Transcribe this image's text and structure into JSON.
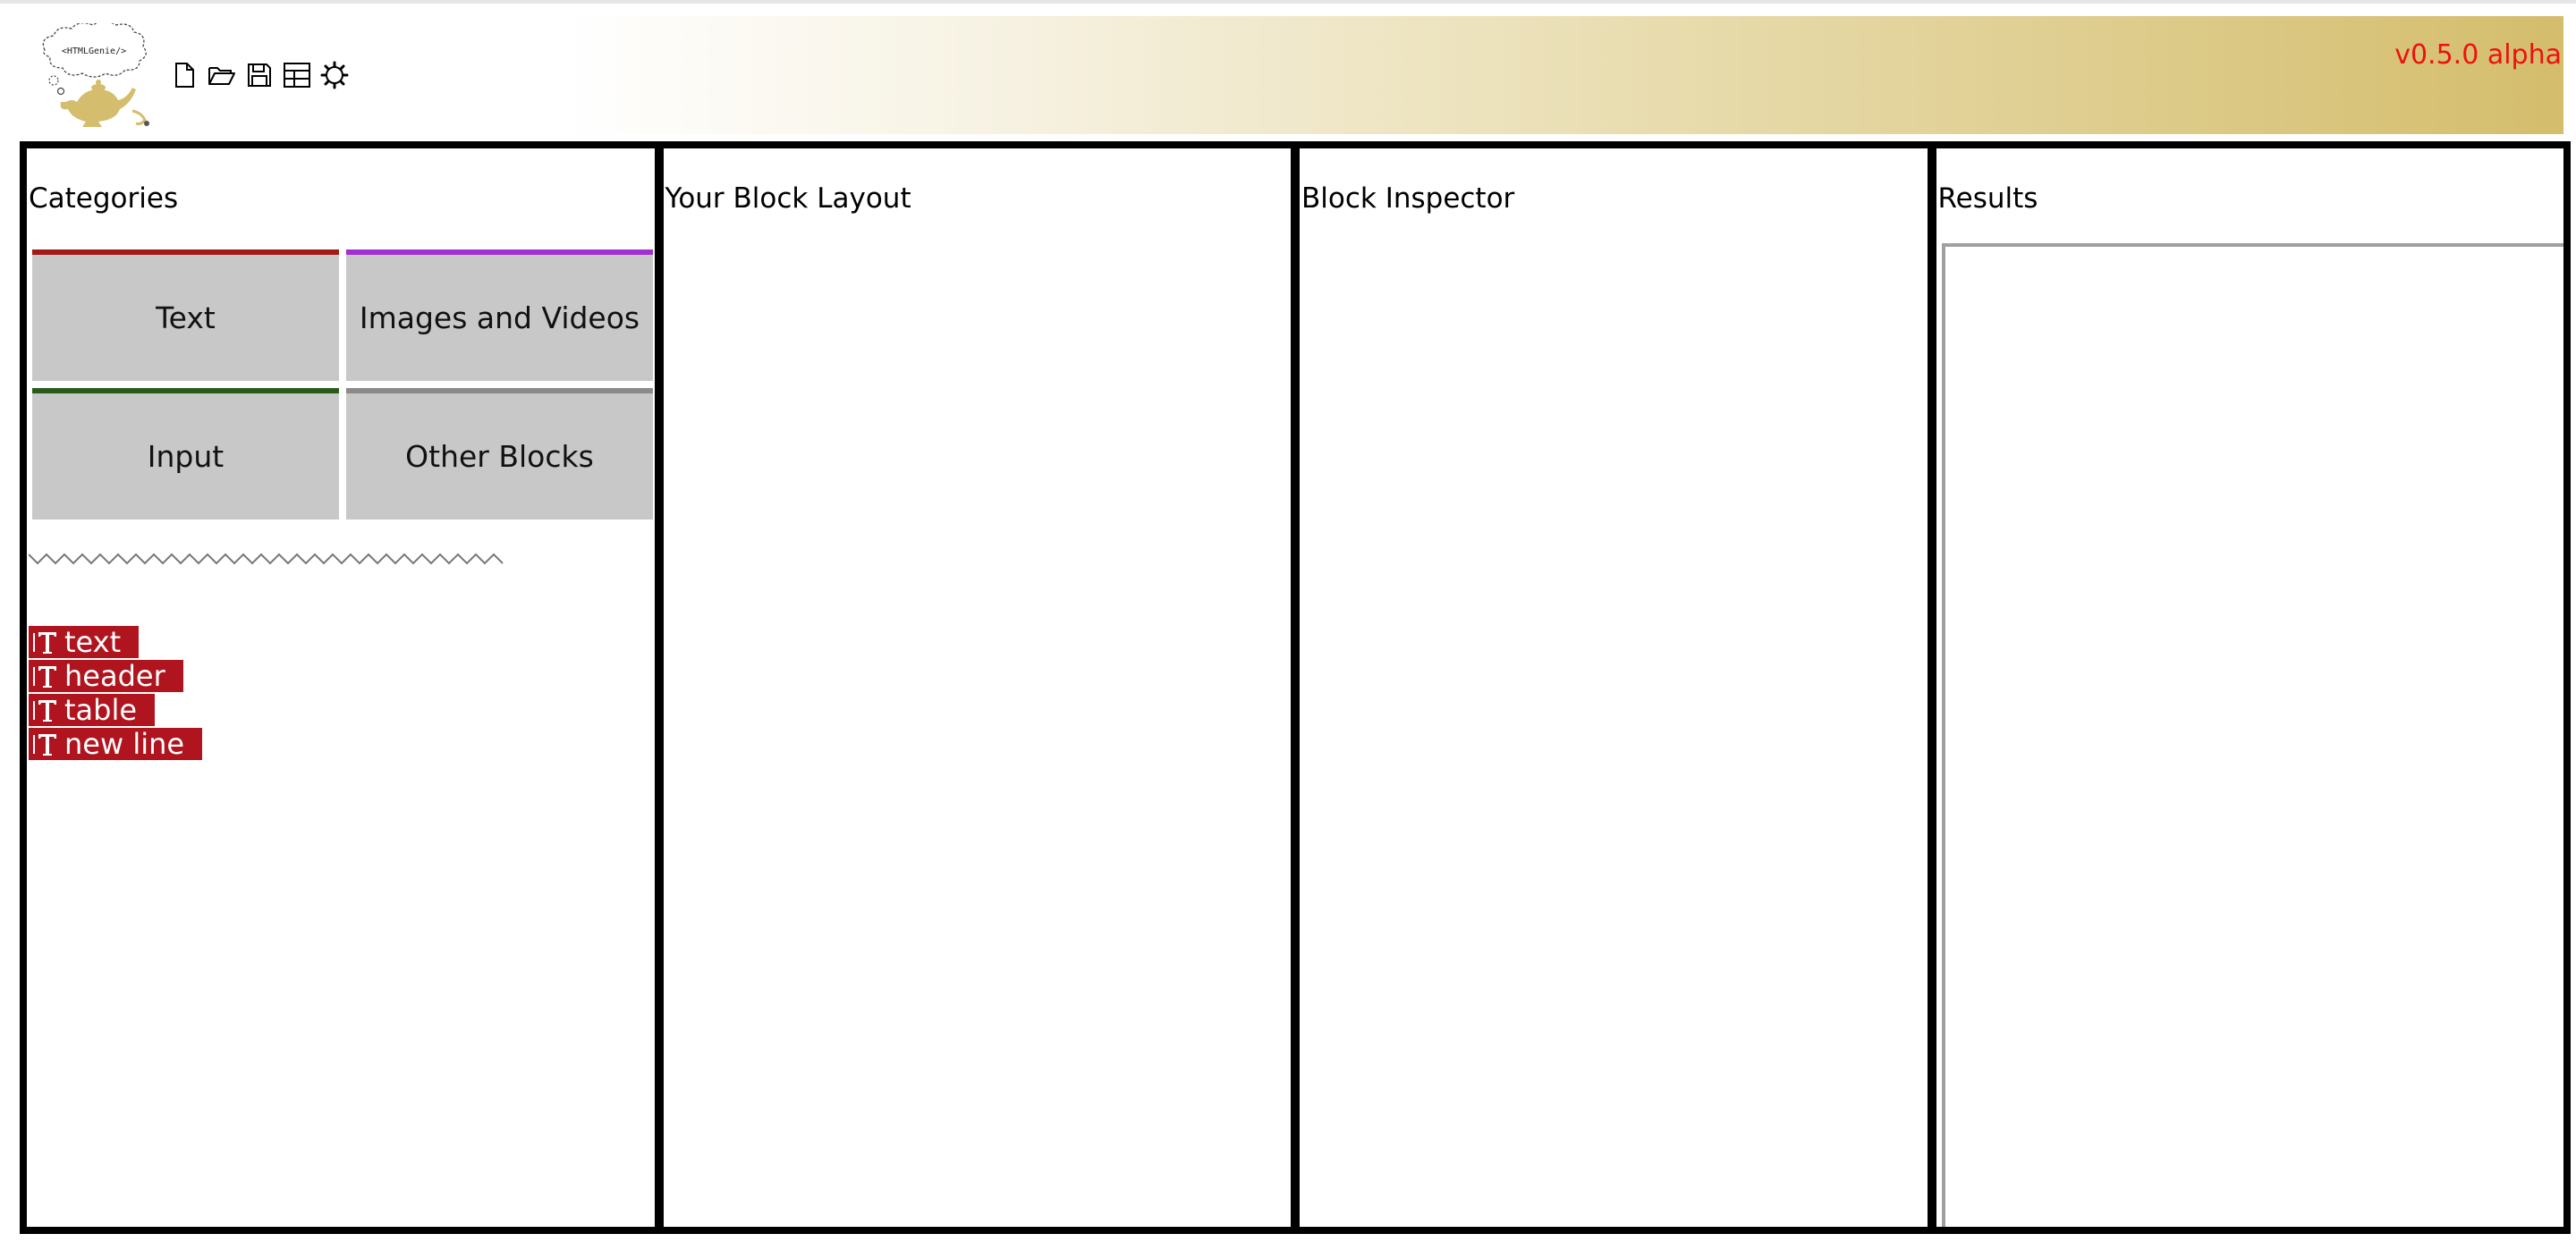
{
  "app": {
    "logo_text": "<HTMLGenie/>",
    "version": "v0.5.0 alpha",
    "version_color": "#ee1111",
    "brand_gold": "#d4bd6c"
  },
  "toolbar": {
    "items": [
      {
        "name": "new-file",
        "icon": "new-file-icon"
      },
      {
        "name": "open-folder",
        "icon": "open-folder-icon"
      },
      {
        "name": "save",
        "icon": "save-icon"
      },
      {
        "name": "layout",
        "icon": "layout-icon"
      },
      {
        "name": "settings",
        "icon": "gear-icon"
      }
    ]
  },
  "panels": {
    "categories": {
      "title": "Categories"
    },
    "layout": {
      "title": "Your Block Layout"
    },
    "inspector": {
      "title": "Block Inspector"
    },
    "results": {
      "title": "Results"
    }
  },
  "categories": [
    {
      "label": "Text",
      "color": "#a01a1a"
    },
    {
      "label": "Images and Videos",
      "color": "#a22fd0"
    },
    {
      "label": "Input",
      "color": "#2a5a1a"
    },
    {
      "label": "Other Blocks",
      "color": "#8a8a8a"
    }
  ],
  "blocks": [
    {
      "label": "text",
      "icon": "text-block-icon"
    },
    {
      "label": "header",
      "icon": "text-block-icon"
    },
    {
      "label": "table",
      "icon": "text-block-icon"
    },
    {
      "label": "new line",
      "icon": "text-block-icon"
    }
  ],
  "block_color": "#b0141e"
}
